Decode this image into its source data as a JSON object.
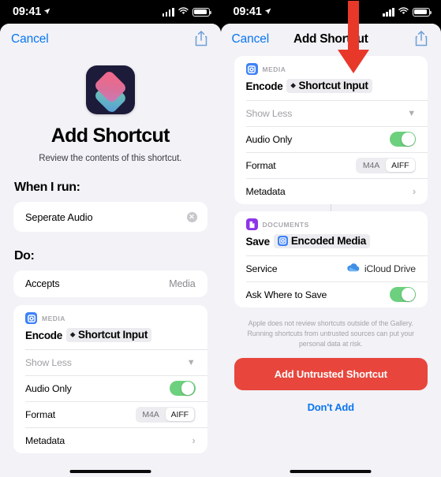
{
  "status_bar": {
    "time": "09:41",
    "location_icon": "location-arrow-icon",
    "signal_icon": "cellular-bars-icon",
    "wifi_icon": "wifi-icon",
    "battery_icon": "battery-full-icon"
  },
  "left_phone": {
    "nav": {
      "cancel": "Cancel",
      "title": "",
      "share_icon": "share-icon"
    },
    "hero": {
      "app_icon": "shortcuts-app-icon",
      "title": "Add Shortcut",
      "subtitle": "Review the contents of this shortcut."
    },
    "when_i_run": {
      "label": "When I run:",
      "value": "Seperate Audio",
      "clear_icon": "clear-text-icon"
    },
    "do": {
      "label": "Do:"
    },
    "accepts": {
      "label": "Accepts",
      "value": "Media"
    },
    "encode_action": {
      "category": "MEDIA",
      "category_icon": "media-encode-icon",
      "verb": "Encode",
      "token": "Shortcut Input",
      "token_dot": "⬥",
      "show_less": "Show Less",
      "show_less_icon": "chevron-down-icon",
      "audio_only_label": "Audio Only",
      "audio_only_state": "on",
      "format_label": "Format",
      "format_options": [
        "M4A",
        "AIFF"
      ],
      "format_selected": "AIFF",
      "metadata_label": "Metadata",
      "metadata_icon": "chevron-right-icon"
    }
  },
  "right_phone": {
    "nav": {
      "cancel": "Cancel",
      "title": "Add Shortcut",
      "share_icon": "share-icon"
    },
    "encode_action": {
      "category": "MEDIA",
      "category_icon": "media-encode-icon",
      "verb": "Encode",
      "token": "Shortcut Input",
      "token_dot": "⬥",
      "show_less": "Show Less",
      "show_less_icon": "chevron-down-icon",
      "audio_only_label": "Audio Only",
      "audio_only_state": "on",
      "format_label": "Format",
      "format_options": [
        "M4A",
        "AIFF"
      ],
      "format_selected": "AIFF",
      "metadata_label": "Metadata",
      "metadata_icon": "chevron-right-icon"
    },
    "save_action": {
      "category": "DOCUMENTS",
      "category_icon": "documents-icon",
      "verb": "Save",
      "token": "Encoded Media",
      "token_icon": "media-encode-icon",
      "service_label": "Service",
      "service_value": "iCloud Drive",
      "service_icon": "icloud-icon",
      "ask_where_label": "Ask Where to Save",
      "ask_where_state": "on"
    },
    "disclaimer": "Apple does not review shortcuts outside of the Gallery. Running shortcuts from untrusted sources can put your personal data at risk.",
    "primary_button": "Add Untrusted Shortcut",
    "secondary_button": "Don't Add"
  },
  "annotation": {
    "arrow_icon": "red-down-arrow-annotation",
    "arrow_color": "#E8382A",
    "points_to": "Add Untrusted Shortcut"
  },
  "colors": {
    "accent_blue": "#0B76EF",
    "danger_red": "#E8463C",
    "toggle_green": "#6CD07E",
    "sheet_bg": "#F2F2F7",
    "card_white": "#FFFFFF"
  }
}
